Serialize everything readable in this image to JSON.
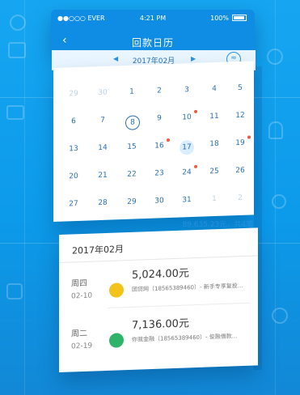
{
  "status": {
    "carrier": "●●○○○ EVER",
    "time": "4:21 PM",
    "battery": "100%"
  },
  "nav": {
    "back": "‹",
    "title": "回款日历"
  },
  "month_bar": {
    "prev": "◀",
    "month": "2017年02月",
    "next": "▶",
    "right_icon": "≈"
  },
  "calendar": {
    "rows": [
      [
        {
          "d": "29",
          "gray": true
        },
        {
          "d": "30",
          "gray": true
        },
        {
          "d": "1"
        },
        {
          "d": "2"
        },
        {
          "d": "3"
        },
        {
          "d": "4"
        },
        {
          "d": "5"
        }
      ],
      [
        {
          "d": "6"
        },
        {
          "d": "7"
        },
        {
          "d": "8",
          "ring": true
        },
        {
          "d": "9"
        },
        {
          "d": "10",
          "dot": true
        },
        {
          "d": "11"
        },
        {
          "d": "12"
        }
      ],
      [
        {
          "d": "13"
        },
        {
          "d": "14"
        },
        {
          "d": "15"
        },
        {
          "d": "16",
          "dot": true
        },
        {
          "d": "17",
          "hl": true
        },
        {
          "d": "18"
        },
        {
          "d": "19",
          "dot": true
        }
      ],
      [
        {
          "d": "20"
        },
        {
          "d": "21"
        },
        {
          "d": "22"
        },
        {
          "d": "23"
        },
        {
          "d": "24",
          "dot": true
        },
        {
          "d": "25"
        },
        {
          "d": "26"
        }
      ],
      [
        {
          "d": "27"
        },
        {
          "d": "28"
        },
        {
          "d": "29"
        },
        {
          "d": "30"
        },
        {
          "d": "31"
        },
        {
          "d": "1",
          "gray": true
        },
        {
          "d": "2",
          "gray": true
        }
      ]
    ]
  },
  "summary": "89,635.23元，共4笔",
  "list": {
    "header": "2017年02月",
    "entries": [
      {
        "weekday": "周四",
        "date": "02-10",
        "amount": "5,024.00元",
        "desc": "团贷网（18565389460）- 新手专享复投...",
        "logo_color": "#f3c21b"
      },
      {
        "weekday": "周二",
        "date": "02-19",
        "amount": "7,136.00元",
        "desc": "你我金融（18565389460）- 俊融借款...",
        "logo_color": "#2fb36a"
      }
    ]
  }
}
